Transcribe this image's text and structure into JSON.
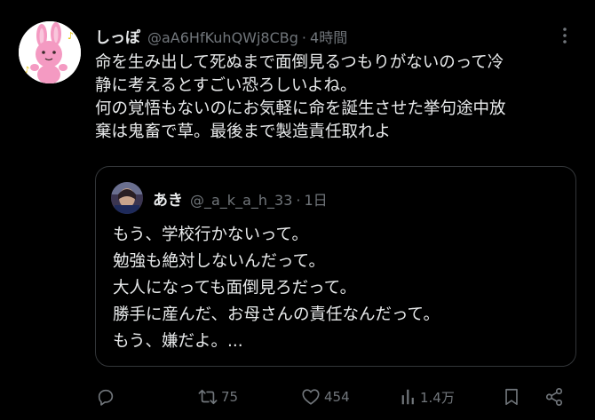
{
  "tweet": {
    "display_name": "しっぽ",
    "handle": "@aA6HfKuhQWj8CBg",
    "separator": "·",
    "time": "4時間",
    "lines": [
      "命を生み出して死ぬまで面倒見るつもりがないのって冷",
      "静に考えるとすごい恐ろしいよね。",
      "何の覚悟もないのにお気軽に命を誕生させた挙句途中放",
      "棄は鬼畜で草。最後まで製造責任取れよ"
    ]
  },
  "quote": {
    "display_name": "あき",
    "handle": "@_a_k_a_h_33",
    "separator": "·",
    "time": "1日",
    "lines": [
      "もう、学校行かないって。",
      "勉強も絶対しないんだって。",
      "大人になっても面倒見ろだって。",
      "勝手に産んだ、お母さんの責任なんだって。",
      "もう、嫌だよ。..."
    ]
  },
  "actions": {
    "reply_icon": "reply-icon",
    "retweet_icon": "retweet-icon",
    "retweet_count": "75",
    "like_icon": "heart-icon",
    "like_count": "454",
    "views_icon": "analytics-icon",
    "view_count": "1.4万",
    "bookmark_icon": "bookmark-icon",
    "share_icon": "share-icon"
  },
  "colors": {
    "background": "#000000",
    "text": "#e7e9ea",
    "muted": "#71767b",
    "border": "#333639",
    "avatar_pink": "#f49ac2"
  }
}
